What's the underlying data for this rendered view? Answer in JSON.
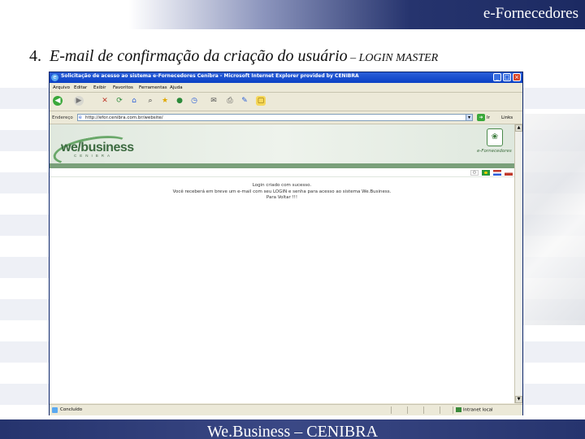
{
  "slide": {
    "header_title": "e-Fornecedores",
    "heading_number": "4.",
    "heading_text": "E-mail de confirmação da criação do usuário",
    "heading_sub": " – LOGIN MASTER",
    "footer_title": "We.Business – CENIBRA"
  },
  "browser": {
    "window_title": "Solicitação de acesso ao sistema e-Fornecedores Cenibra - Microsoft Internet Explorer provided by CENIBRA",
    "menu": [
      "Arquivo",
      "Editar",
      "Exibir",
      "Favoritos",
      "Ferramentas",
      "Ajuda"
    ],
    "address_label": "Endereço",
    "url": "http://efor.cenibra.com.br/website/",
    "go_label": "Ir",
    "links_label": "Links",
    "status_text": "Concluído",
    "zone_text": "Intranet local"
  },
  "page": {
    "logo_text": "we/business",
    "logo_sub": "CENIBRA",
    "eforn_label": "e-Fornecedores",
    "message_lines": [
      "Login criado com sucesso.",
      "Você receberá em breve um e-mail com seu LOGIN e senha para acesso ao sistema We.Business.",
      "Para Voltar !!!"
    ]
  },
  "colors": {
    "slide_bar": "#26346e",
    "site_green": "#7aa07a",
    "xp_title": "#0a40c4"
  }
}
